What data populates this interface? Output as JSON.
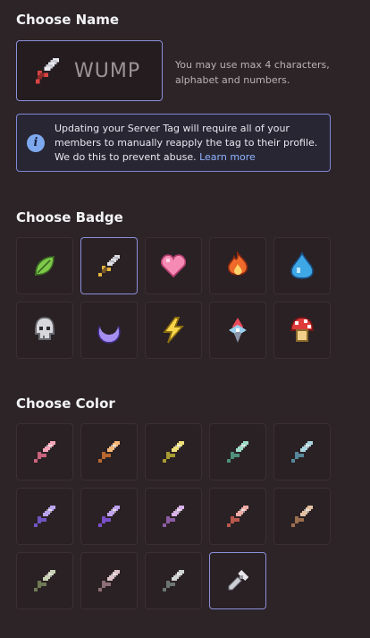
{
  "name_section": {
    "title": "Choose Name",
    "tag_value": "WUMP",
    "hint": "You may use max 4 characters, alphabet and numbers."
  },
  "notice": {
    "icon": "info-icon",
    "text": "Updating your Server Tag will require all of your members to manually reapply the tag to their profile. We do this to prevent abuse.",
    "link": "Learn more"
  },
  "badge_section": {
    "title": "Choose Badge",
    "selected_index": 1,
    "badges": [
      {
        "name": "leaf-icon"
      },
      {
        "name": "sword-icon"
      },
      {
        "name": "heart-icon"
      },
      {
        "name": "fire-icon"
      },
      {
        "name": "water-drop-icon"
      },
      {
        "name": "skull-icon"
      },
      {
        "name": "crescent-moon-icon"
      },
      {
        "name": "lightning-icon"
      },
      {
        "name": "crystal-icon"
      },
      {
        "name": "mushroom-icon"
      }
    ]
  },
  "color_section": {
    "title": "Choose Color",
    "colors": [
      {
        "name": "pink-sword-icon",
        "blade": "#f2a6b8",
        "hilt": "#c9627c"
      },
      {
        "name": "orange-sword-icon",
        "blade": "#f4b97a",
        "hilt": "#b8672e"
      },
      {
        "name": "yellow-sword-icon",
        "blade": "#ece07a",
        "hilt": "#a89b32"
      },
      {
        "name": "teal-sword-icon",
        "blade": "#9fdcc8",
        "hilt": "#4e8f7c"
      },
      {
        "name": "light-blue-sword-icon",
        "blade": "#a9d5e0",
        "hilt": "#55879a"
      },
      {
        "name": "lavender-sword-icon",
        "blade": "#b9a4ef",
        "hilt": "#6f55c2"
      },
      {
        "name": "violet-sword-icon",
        "blade": "#c1a3f0",
        "hilt": "#7a4fc9"
      },
      {
        "name": "mauve-sword-icon",
        "blade": "#d9b2e6",
        "hilt": "#8c5ca3"
      },
      {
        "name": "salmon-sword-icon",
        "blade": "#f0aca6",
        "hilt": "#b9584d"
      },
      {
        "name": "tan-sword-icon",
        "blade": "#e3c1a3",
        "hilt": "#9c6f4f"
      },
      {
        "name": "olive-sword-icon",
        "blade": "#c8d0b5",
        "hilt": "#6f7a55"
      },
      {
        "name": "rosy-gray-sword-icon",
        "blade": "#dcc3c9",
        "hilt": "#8c6f76"
      },
      {
        "name": "gray-sword-icon",
        "blade": "#cfd4d2",
        "hilt": "#6d7572"
      },
      {
        "name": "custom-color-picker-icon",
        "picker": true
      }
    ]
  }
}
